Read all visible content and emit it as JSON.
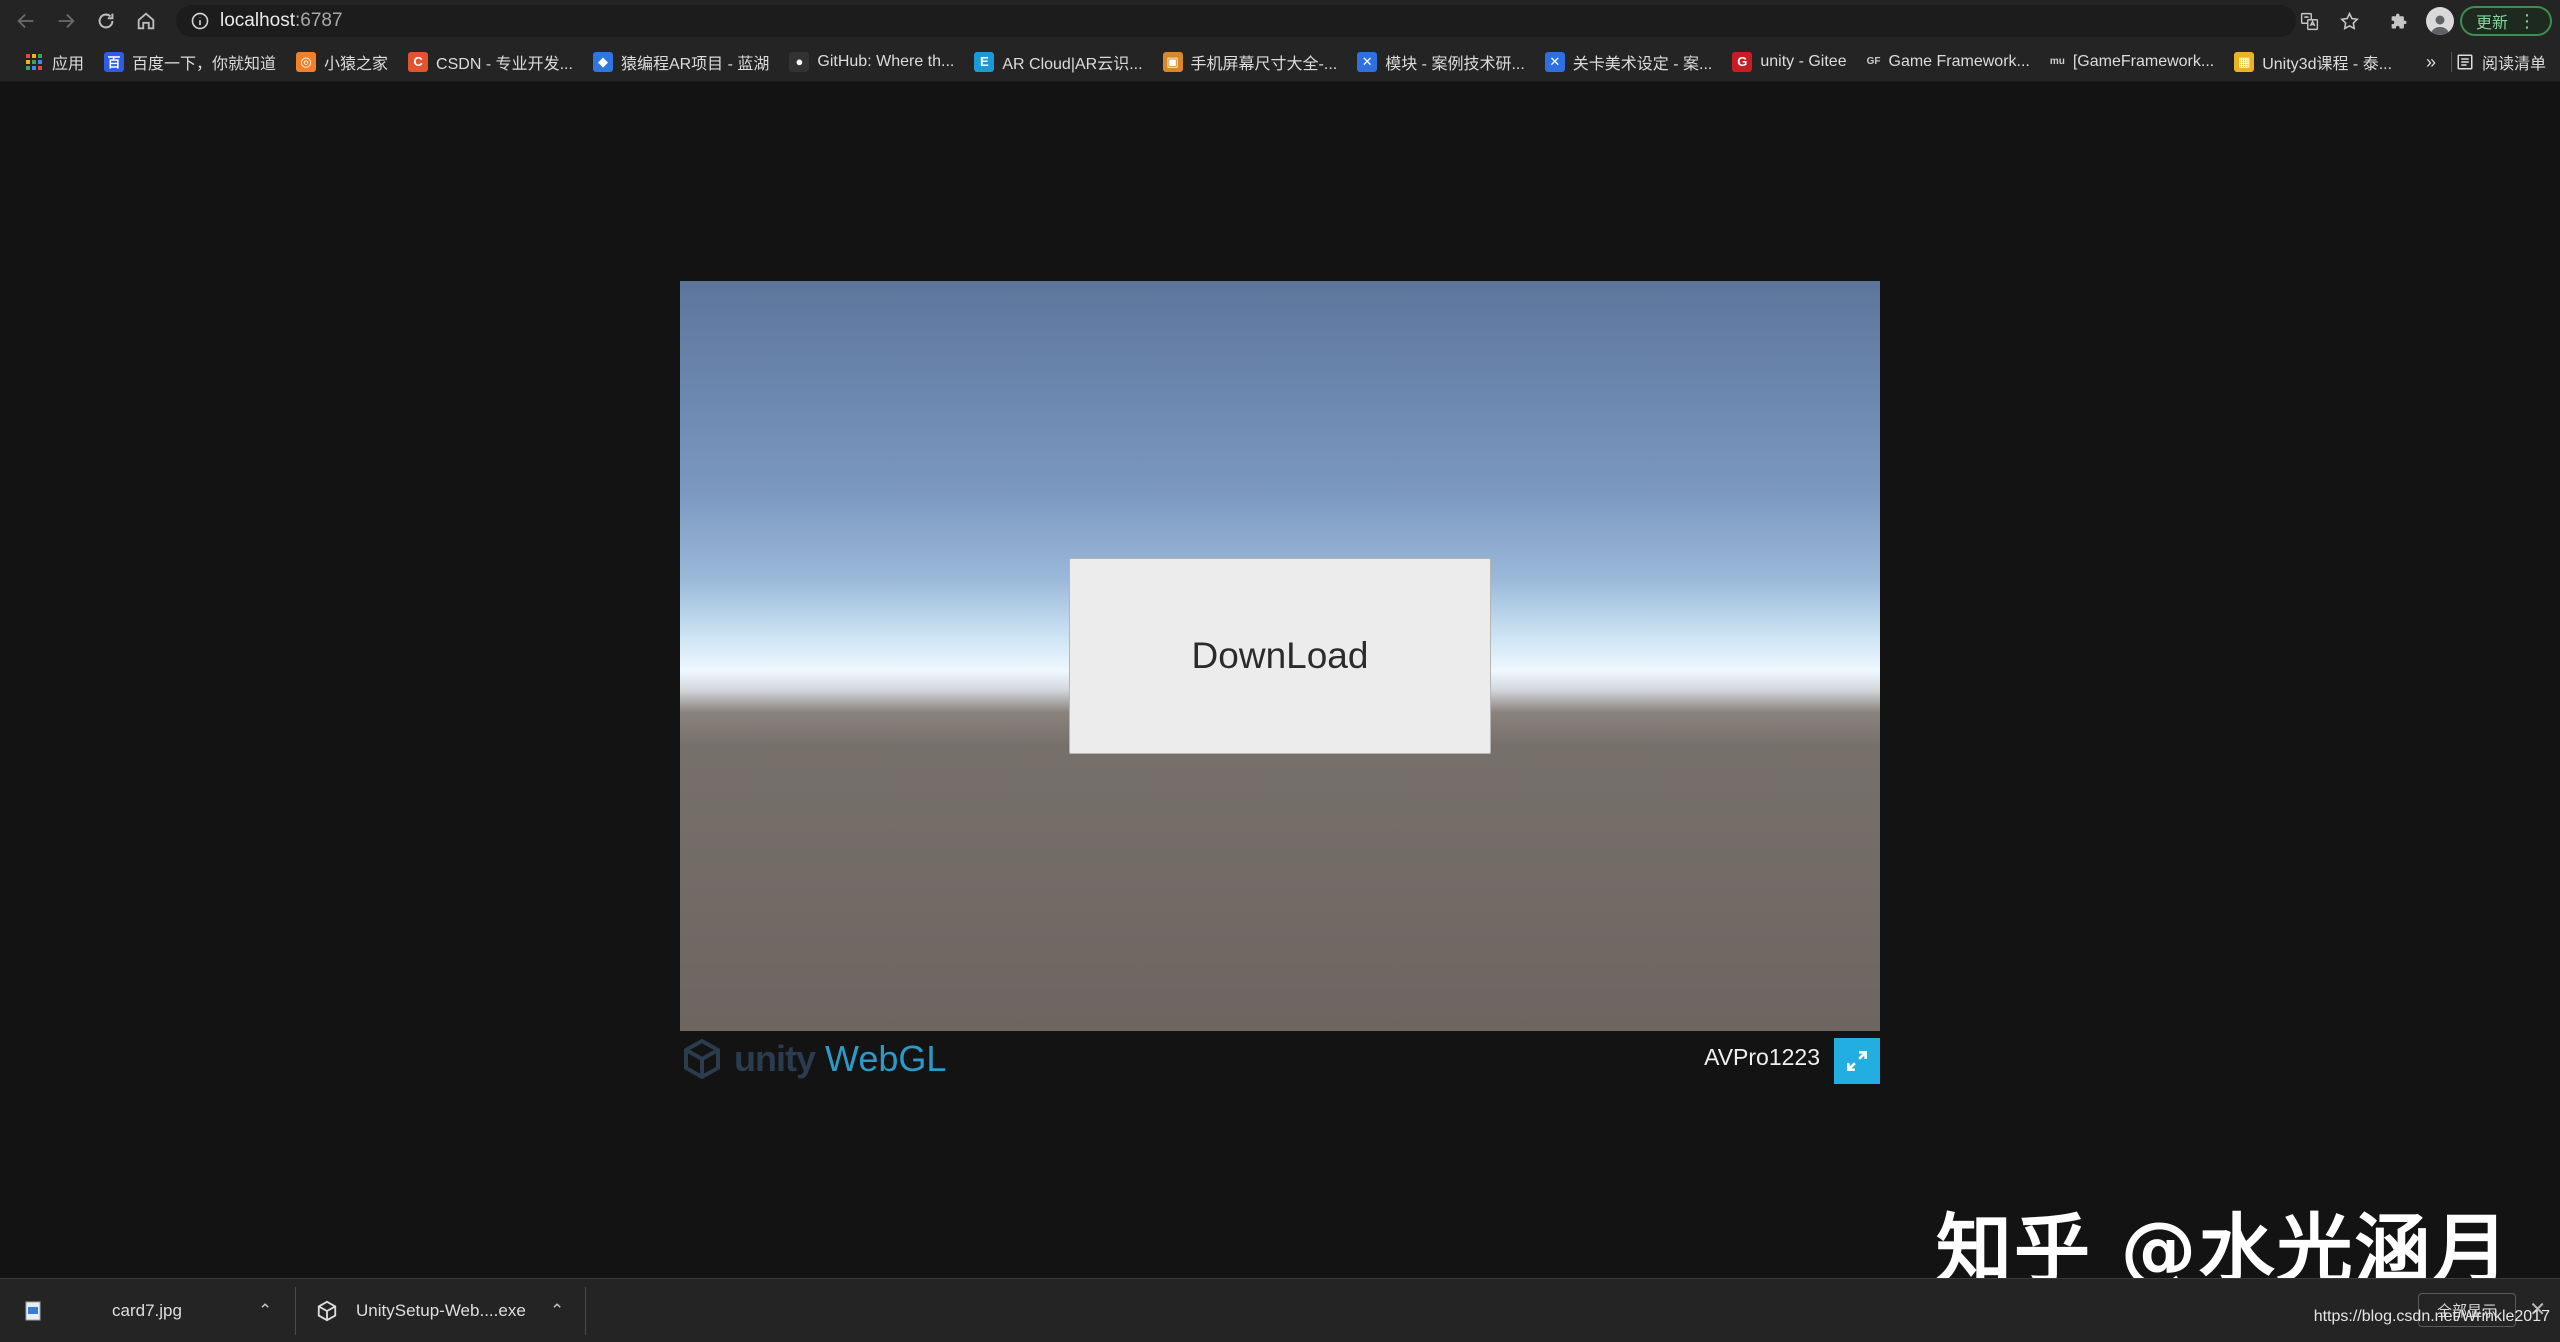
{
  "browser": {
    "url_host": "localhost",
    "url_port": ":6787",
    "update_label": "更新"
  },
  "bookmarks": {
    "items": [
      {
        "label": "应用",
        "icon": "apps-grid-icon",
        "color": "#e8453c"
      },
      {
        "label": "百度一下，你就知道",
        "icon": "baidu-icon",
        "color": "#2f5ce6"
      },
      {
        "label": "小猿之家",
        "icon": "xiaoyuan-icon",
        "color": "#f0812a"
      },
      {
        "label": "CSDN - 专业开发...",
        "icon": "csdn-icon",
        "color": "#e4532d"
      },
      {
        "label": "猿编程AR项目 - 蓝湖",
        "icon": "lanhu-icon",
        "color": "#2f77e0"
      },
      {
        "label": "GitHub: Where th...",
        "icon": "github-icon",
        "color": "#333333"
      },
      {
        "label": "AR Cloud|AR云识...",
        "icon": "arcloud-icon",
        "color": "#1a9bd8"
      },
      {
        "label": "手机屏幕尺寸大全-...",
        "icon": "phone-size-icon",
        "color": "#d48a2b"
      },
      {
        "label": "模块 - 案例技术研...",
        "icon": "confluence-icon",
        "color": "#2f6fe0"
      },
      {
        "label": "关卡美术设定 - 案...",
        "icon": "confluence-icon",
        "color": "#2f6fe0"
      },
      {
        "label": "unity - Gitee",
        "icon": "gitee-icon",
        "color": "#c71d23"
      },
      {
        "label": "Game Framework...",
        "icon": "gf-icon",
        "color": "#555555"
      },
      {
        "label": "[GameFramework...",
        "icon": "mu-icon",
        "color": "#555555"
      },
      {
        "label": "Unity3d课程 - 泰...",
        "icon": "unity-course-icon",
        "color": "#e8b422"
      }
    ],
    "more": "»",
    "reading_list": "阅读清单"
  },
  "unity": {
    "button_label": "DownLoad",
    "logo_unity": "unity",
    "logo_webgl": "WebGL",
    "title": "AVPro1223"
  },
  "watermark": "知乎 @水光涵月",
  "downloads": {
    "items": [
      {
        "name": "card7.jpg"
      },
      {
        "name": "UnitySetup-Web....exe"
      }
    ],
    "show_all": "全部显示"
  },
  "blog_url": "https://blog.csdn.net/Wrinkle2017"
}
